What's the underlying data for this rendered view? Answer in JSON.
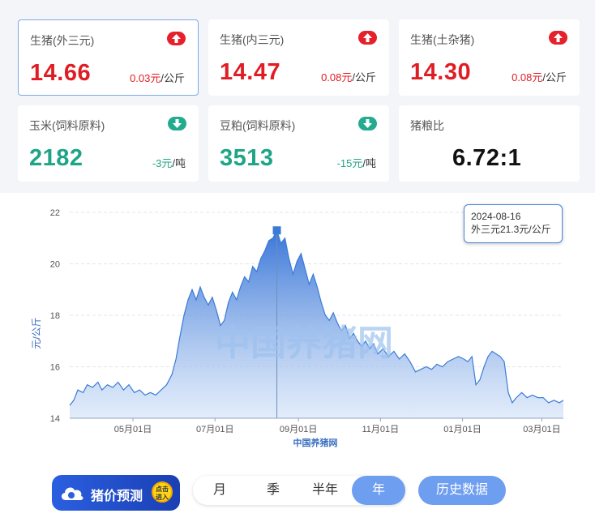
{
  "cards": [
    {
      "name": "生猪(外三元)",
      "value": "14.66",
      "change": "0.03元",
      "unit": "/公斤",
      "trend": "up",
      "color": "red"
    },
    {
      "name": "生猪(内三元)",
      "value": "14.47",
      "change": "0.08元",
      "unit": "/公斤",
      "trend": "up",
      "color": "red"
    },
    {
      "name": "生猪(土杂猪)",
      "value": "14.30",
      "change": "0.08元",
      "unit": "/公斤",
      "trend": "up",
      "color": "red"
    },
    {
      "name": "玉米(饲料原料)",
      "value": "2182",
      "change": "-3元",
      "unit": "/吨",
      "trend": "down",
      "color": "green"
    },
    {
      "name": "豆粕(饲料原料)",
      "value": "3513",
      "change": "-15元",
      "unit": "/吨",
      "trend": "down",
      "color": "green"
    },
    {
      "name": "猪粮比",
      "value": "6.72:1"
    }
  ],
  "tooltip": {
    "date": "2024-08-16",
    "text": "外三元21.3元/公斤"
  },
  "watermark": "中国养猪网",
  "predict_button": {
    "label": "猪价预测",
    "seal": "点击进入"
  },
  "range_tabs": [
    "月",
    "季",
    "半年",
    "年"
  ],
  "active_range": "年",
  "history_button": "历史数据",
  "colors": {
    "up": "#e01d24",
    "down": "#1ea585",
    "accent": "#6e9ef0",
    "line": "#3b7bd6"
  },
  "chart_data": {
    "type": "area",
    "ylabel": "元/公斤",
    "xlabel": "中国养猪网",
    "ylim": [
      14,
      22
    ],
    "yticks": [
      14,
      16,
      18,
      20,
      22
    ],
    "xticks": [
      "05月01日",
      "07月01日",
      "09月01日",
      "11月01日",
      "01月01日",
      "03月01日"
    ],
    "x_range": [
      "2024-03-15",
      "2025-03-17"
    ],
    "xtick_dates": [
      "2024-05-01",
      "2024-07-01",
      "2024-09-01",
      "2024-11-01",
      "2025-01-01",
      "2025-03-01"
    ],
    "highlight": {
      "date": "2024-08-16",
      "value": 21.3
    },
    "series": [
      {
        "points": [
          [
            "2024-03-15",
            14.5
          ],
          [
            "2024-03-18",
            14.7
          ],
          [
            "2024-03-21",
            15.1
          ],
          [
            "2024-03-25",
            15.0
          ],
          [
            "2024-03-28",
            15.3
          ],
          [
            "2024-04-01",
            15.2
          ],
          [
            "2024-04-05",
            15.4
          ],
          [
            "2024-04-08",
            15.1
          ],
          [
            "2024-04-12",
            15.3
          ],
          [
            "2024-04-16",
            15.2
          ],
          [
            "2024-04-20",
            15.4
          ],
          [
            "2024-04-24",
            15.1
          ],
          [
            "2024-04-28",
            15.3
          ],
          [
            "2024-05-02",
            15.0
          ],
          [
            "2024-05-06",
            15.1
          ],
          [
            "2024-05-10",
            14.9
          ],
          [
            "2024-05-14",
            15.0
          ],
          [
            "2024-05-18",
            14.9
          ],
          [
            "2024-05-22",
            15.1
          ],
          [
            "2024-05-26",
            15.3
          ],
          [
            "2024-05-30",
            15.7
          ],
          [
            "2024-06-02",
            16.3
          ],
          [
            "2024-06-05",
            17.2
          ],
          [
            "2024-06-08",
            18.0
          ],
          [
            "2024-06-11",
            18.6
          ],
          [
            "2024-06-14",
            19.0
          ],
          [
            "2024-06-17",
            18.6
          ],
          [
            "2024-06-20",
            19.1
          ],
          [
            "2024-06-23",
            18.7
          ],
          [
            "2024-06-26",
            18.4
          ],
          [
            "2024-06-29",
            18.7
          ],
          [
            "2024-07-02",
            18.2
          ],
          [
            "2024-07-05",
            17.6
          ],
          [
            "2024-07-08",
            17.8
          ],
          [
            "2024-07-11",
            18.5
          ],
          [
            "2024-07-14",
            18.9
          ],
          [
            "2024-07-17",
            18.6
          ],
          [
            "2024-07-20",
            19.1
          ],
          [
            "2024-07-23",
            19.5
          ],
          [
            "2024-07-26",
            19.3
          ],
          [
            "2024-07-29",
            19.9
          ],
          [
            "2024-08-01",
            19.7
          ],
          [
            "2024-08-04",
            20.2
          ],
          [
            "2024-08-07",
            20.5
          ],
          [
            "2024-08-10",
            20.9
          ],
          [
            "2024-08-13",
            21.0
          ],
          [
            "2024-08-16",
            21.3
          ],
          [
            "2024-08-19",
            20.8
          ],
          [
            "2024-08-22",
            21.0
          ],
          [
            "2024-08-25",
            20.2
          ],
          [
            "2024-08-28",
            19.6
          ],
          [
            "2024-08-31",
            20.1
          ],
          [
            "2024-09-03",
            20.4
          ],
          [
            "2024-09-06",
            19.8
          ],
          [
            "2024-09-09",
            19.2
          ],
          [
            "2024-09-12",
            19.6
          ],
          [
            "2024-09-15",
            19.1
          ],
          [
            "2024-09-18",
            18.5
          ],
          [
            "2024-09-21",
            18.0
          ],
          [
            "2024-09-24",
            17.8
          ],
          [
            "2024-09-27",
            18.1
          ],
          [
            "2024-09-30",
            17.7
          ],
          [
            "2024-10-03",
            17.4
          ],
          [
            "2024-10-06",
            17.6
          ],
          [
            "2024-10-09",
            17.1
          ],
          [
            "2024-10-12",
            17.3
          ],
          [
            "2024-10-15",
            17.0
          ],
          [
            "2024-10-18",
            16.8
          ],
          [
            "2024-10-21",
            17.0
          ],
          [
            "2024-10-24",
            16.7
          ],
          [
            "2024-10-27",
            16.9
          ],
          [
            "2024-10-30",
            16.5
          ],
          [
            "2024-11-03",
            16.7
          ],
          [
            "2024-11-07",
            16.4
          ],
          [
            "2024-11-11",
            16.6
          ],
          [
            "2024-11-15",
            16.3
          ],
          [
            "2024-11-19",
            16.5
          ],
          [
            "2024-11-23",
            16.2
          ],
          [
            "2024-11-27",
            15.8
          ],
          [
            "2024-12-01",
            15.9
          ],
          [
            "2024-12-05",
            16.0
          ],
          [
            "2024-12-09",
            15.9
          ],
          [
            "2024-12-13",
            16.1
          ],
          [
            "2024-12-17",
            16.0
          ],
          [
            "2024-12-21",
            16.2
          ],
          [
            "2024-12-25",
            16.3
          ],
          [
            "2024-12-29",
            16.4
          ],
          [
            "2025-01-02",
            16.3
          ],
          [
            "2025-01-05",
            16.2
          ],
          [
            "2025-01-08",
            16.4
          ],
          [
            "2025-01-11",
            15.3
          ],
          [
            "2025-01-14",
            15.5
          ],
          [
            "2025-01-17",
            16.0
          ],
          [
            "2025-01-20",
            16.4
          ],
          [
            "2025-01-23",
            16.6
          ],
          [
            "2025-01-26",
            16.5
          ],
          [
            "2025-01-29",
            16.4
          ],
          [
            "2025-02-01",
            16.2
          ],
          [
            "2025-02-04",
            15.0
          ],
          [
            "2025-02-07",
            14.6
          ],
          [
            "2025-02-10",
            14.8
          ],
          [
            "2025-02-14",
            15.0
          ],
          [
            "2025-02-18",
            14.8
          ],
          [
            "2025-02-22",
            14.9
          ],
          [
            "2025-02-26",
            14.8
          ],
          [
            "2025-03-02",
            14.8
          ],
          [
            "2025-03-06",
            14.6
          ],
          [
            "2025-03-10",
            14.7
          ],
          [
            "2025-03-14",
            14.6
          ],
          [
            "2025-03-17",
            14.7
          ]
        ]
      }
    ]
  }
}
